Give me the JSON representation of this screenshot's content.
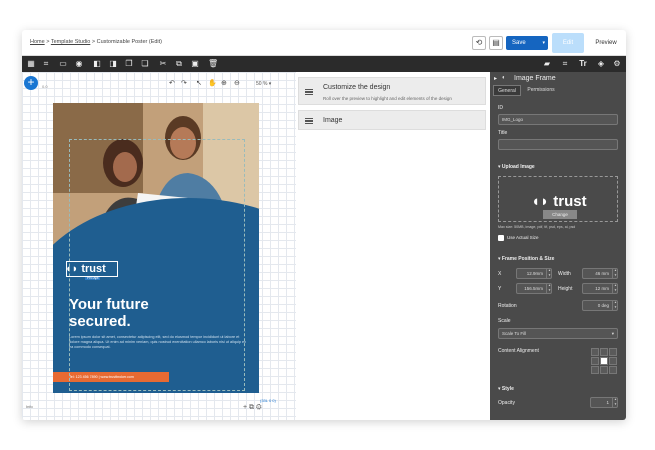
{
  "breadcrumb": {
    "home": "Home",
    "sep1": ">",
    "studio": "Template Studio",
    "sep2": ">",
    "current": "Customizable Poster (Edit)"
  },
  "header": {
    "save_label": "Save",
    "edit_label": "Edit",
    "preview_label": "Preview"
  },
  "canvas": {
    "zoom": "50 %",
    "ruler_left": "0.0",
    "footer_coords": "(33L 0 0)",
    "bottom_left": "Info"
  },
  "poster": {
    "logo_text": "trust",
    "logo_sub": "Pro Apt",
    "headline1": "Your future",
    "headline2": "secured.",
    "body": "Lorem ipsum dolor sit amet, consectetur adipiscing elit, sed do eiusmod tempor incididunt ut labore et dolore magna aliqua. Ut enim ad minim veniam, quis nostrud exercitation ullamco laboris nisi ut aliquip ex ea commodo consequat.",
    "cta": "Tel: 123 456 7890  |  www.trustbroker.com"
  },
  "layers": [
    {
      "title": "Customize the design",
      "subtitle": "Roll over the preview to highlight and edit elements of the design"
    },
    {
      "title": "Image",
      "subtitle": ""
    }
  ],
  "panel": {
    "title": "Image Frame",
    "tabs": [
      "General",
      "Permissions"
    ],
    "id_label": "ID",
    "id_value": "IMG_Logo",
    "title_label": "Title",
    "title_value": "",
    "upload_section": "Upload Image",
    "upload_logo": "trust",
    "change_label": "Change",
    "upload_hint": "Max size: 50MB, image, pdf, tif, psd, eps, ai, psd",
    "actual_size": "Use Actual Size",
    "position_section": "Frame Position & Size",
    "x_label": "X",
    "x_value": "12.9mm",
    "width_label": "Width",
    "width_value": "46 mm",
    "y_label": "Y",
    "y_value": "156.5mm",
    "height_label": "Height",
    "height_value": "12 mm",
    "rotation_label": "Rotation",
    "rotation_value": "0 deg",
    "scale_label": "Scale",
    "scale_value": "Scale To Fill",
    "content_alignment_label": "Content Alignment",
    "style_section": "Style",
    "opacity_label": "Opacity",
    "opacity_value": "1"
  },
  "colors": {
    "accent": "#1565c0",
    "poster_blue": "#1d5a8a",
    "cta_orange": "#e86a32",
    "panel_bg": "#4a4a4a"
  }
}
